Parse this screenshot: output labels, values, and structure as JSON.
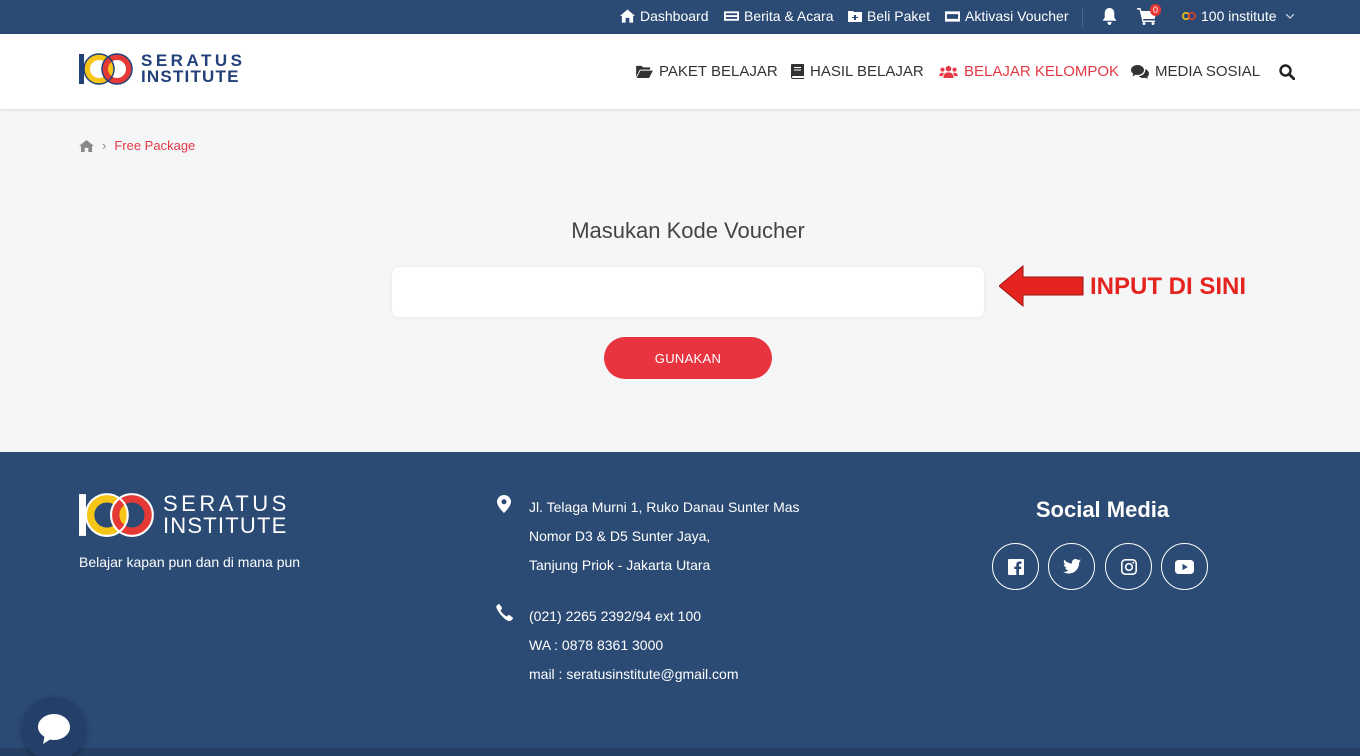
{
  "topbar": {
    "dashboard": "Dashboard",
    "news": "Berita & Acara",
    "buy": "Beli Paket",
    "voucher": "Aktivasi Voucher",
    "cart_count": "0",
    "account": "100 institute"
  },
  "logo": {
    "line1": "SERATUS",
    "line2": "INSTITUTE"
  },
  "nav": {
    "items": [
      {
        "label": "PAKET BELAJAR"
      },
      {
        "label": "HASIL BELAJAR"
      },
      {
        "label": "BELAJAR KELOMPOK"
      },
      {
        "label": "MEDIA SOSIAL"
      }
    ],
    "active_color": "#e53945"
  },
  "breadcrumb": {
    "current": "Free Package"
  },
  "voucher": {
    "title": "Masukan Kode Voucher",
    "input_value": "",
    "button": "GUNAKAN"
  },
  "annotation": {
    "text": "INPUT DI SINI"
  },
  "footer": {
    "tagline": "Belajar kapan pun dan di mana pun",
    "address": [
      "Jl. Telaga Murni 1, Ruko Danau Sunter Mas",
      "Nomor D3 & D5 Sunter Jaya,",
      "Tanjung Priok - Jakarta Utara"
    ],
    "contact": [
      "(021) 2265 2392/94 ext 100",
      "WA : 0878 8361 3000",
      "mail : seratusinstitute@gmail.com"
    ],
    "social_title": "Social Media"
  },
  "colors": {
    "primary": "#2b4a74",
    "accent": "#e8343f"
  }
}
